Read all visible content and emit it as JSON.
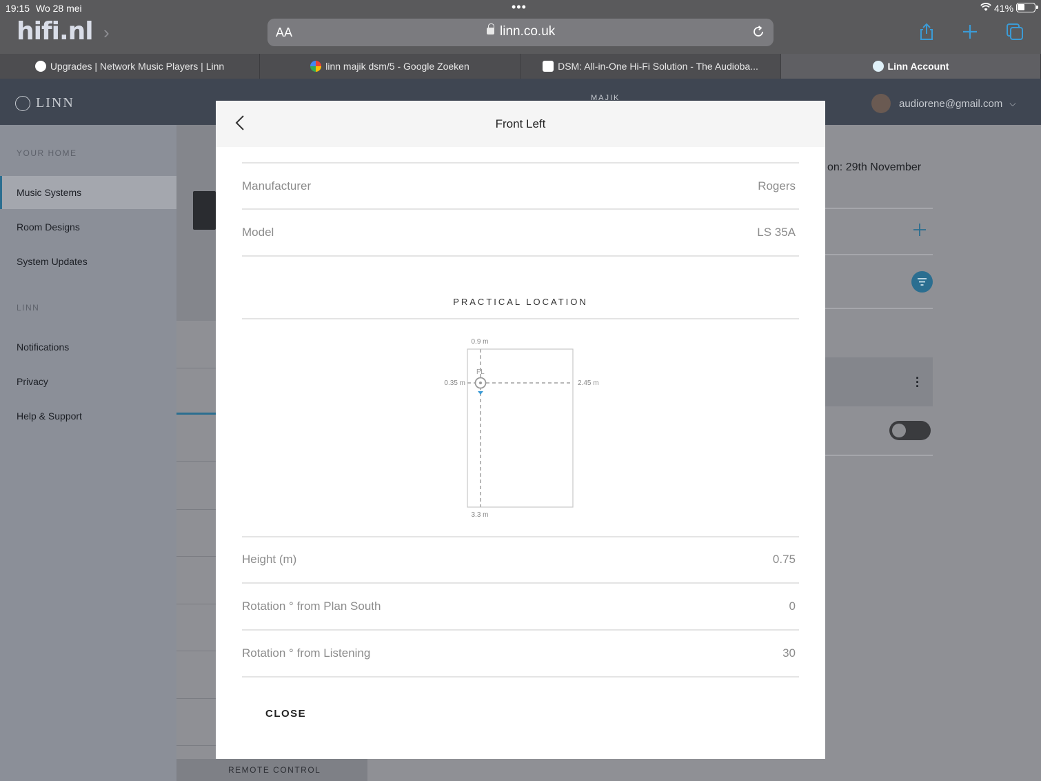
{
  "status_bar": {
    "time": "19:15",
    "date": "Wo 28 mei",
    "battery": "41%"
  },
  "browser": {
    "logo": "hifi.nl",
    "text_size_label": "AA",
    "url": "linn.co.uk",
    "tabs": [
      {
        "label": "Upgrades | Network Music Players | Linn"
      },
      {
        "label": "linn majik dsm/5 - Google Zoeken"
      },
      {
        "label": "DSM: All-in-One Hi-Fi Solution - The Audioba..."
      },
      {
        "label": "Linn Account",
        "active": true
      }
    ]
  },
  "site": {
    "logo": "LINN",
    "header_peek": "MAJIK",
    "user_email": "audiorene@gmail.com",
    "sidebar": {
      "section_home": "YOUR HOME",
      "home_items": [
        {
          "label": "Music Systems",
          "active": true
        },
        {
          "label": "Room Designs"
        },
        {
          "label": "System Updates"
        }
      ],
      "section_linn": "LINN",
      "linn_items": [
        {
          "label": "Notifications"
        },
        {
          "label": "Privacy"
        },
        {
          "label": "Help & Support"
        }
      ]
    },
    "right_text": "on: 29th November",
    "remote_control": "REMOTE CONTROL"
  },
  "modal": {
    "title": "Front Left",
    "rows_top": [
      {
        "label": "Manufacturer",
        "value": "Rogers"
      },
      {
        "label": "Model",
        "value": "LS 35A"
      }
    ],
    "section_title": "PRACTICAL LOCATION",
    "plan": {
      "speaker_label": "FL",
      "top_distance": "0.9 m",
      "left_distance": "0.35 m",
      "right_distance": "2.45 m",
      "bottom_distance": "3.3 m"
    },
    "rows_bottom": [
      {
        "label": "Height (m)",
        "value": "0.75"
      },
      {
        "label": "Rotation ° from Plan South",
        "value": "0"
      },
      {
        "label": "Rotation ° from Listening",
        "value": "30"
      }
    ],
    "close_label": "CLOSE"
  },
  "colors": {
    "accent": "#2b6e90",
    "speaker_marker": "#3b9bd6"
  }
}
